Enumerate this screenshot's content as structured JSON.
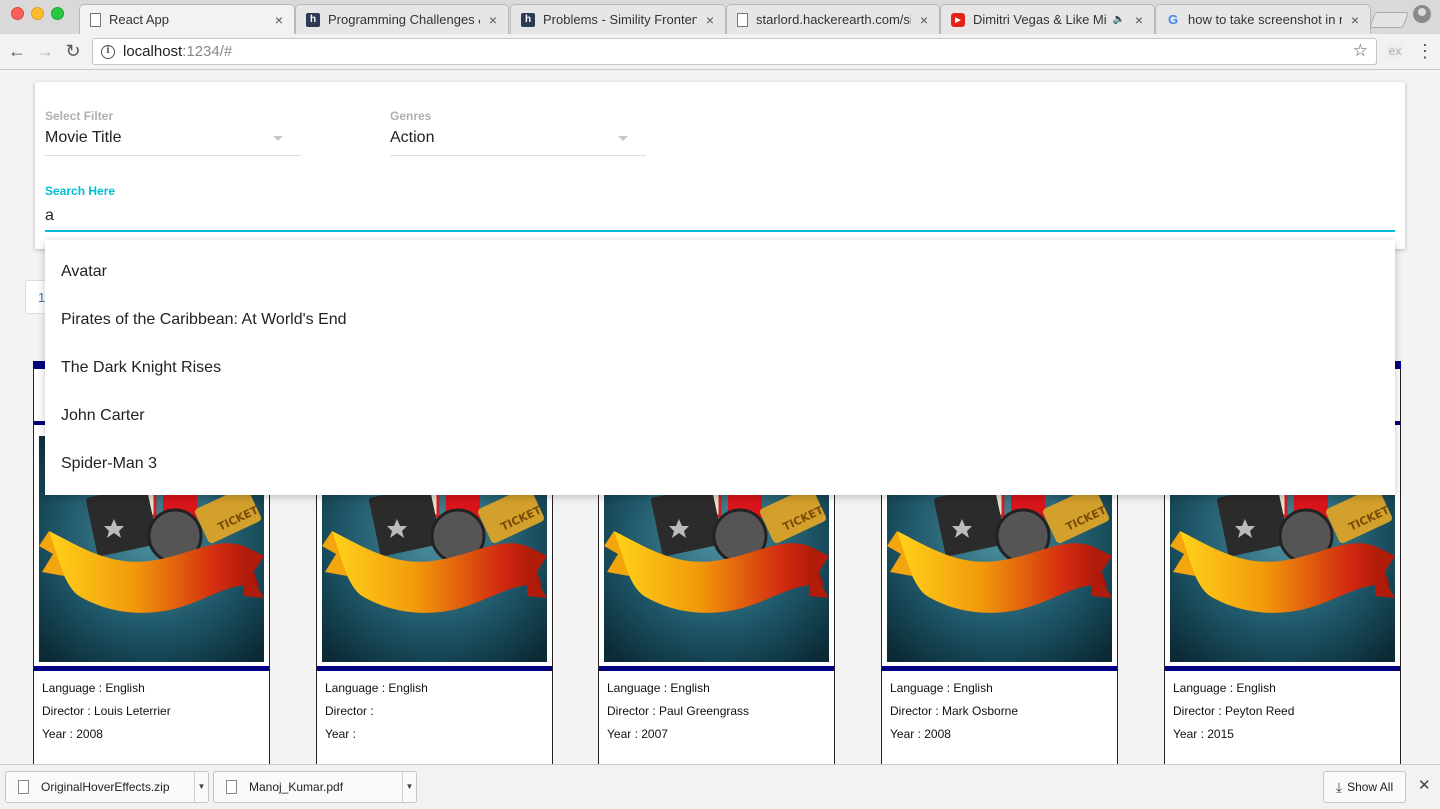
{
  "browser": {
    "tabs": [
      {
        "title": "React App",
        "icon": "document-icon",
        "active": true
      },
      {
        "title": "Programming Challenges & C",
        "icon": "hackerearth-icon"
      },
      {
        "title": "Problems - Simility Frontend",
        "icon": "hackerearth-icon"
      },
      {
        "title": "starlord.hackerearth.com/si",
        "icon": "document-icon"
      },
      {
        "title": "Dimitri Vegas & Like Mike",
        "icon": "youtube-icon",
        "audio": true
      },
      {
        "title": "how to take screenshot in m",
        "icon": "google-icon"
      }
    ],
    "url_host": "localhost",
    "url_rest": ":1234/#",
    "ext_label": "ex"
  },
  "filters": {
    "select_filter_label": "Select Filter",
    "select_filter_value": "Movie Title",
    "genres_label": "Genres",
    "genres_value": "Action",
    "search_label": "Search Here",
    "search_value": "a"
  },
  "autocomplete": [
    "Avatar",
    "Pirates of the Caribbean: At World's End",
    "The Dark Knight Rises",
    "John Carter",
    "Spider-Man 3"
  ],
  "pager_label": "1",
  "movies": [
    {
      "language": "Language : English",
      "director": "Director : Louis Leterrier",
      "year": "Year : 2008"
    },
    {
      "language": "Language : English",
      "director": "Director :",
      "year": "Year :"
    },
    {
      "language": "Language : English",
      "director": "Director : Paul Greengrass",
      "year": "Year : 2007"
    },
    {
      "language": "Language : English",
      "director": "Director : Mark Osborne",
      "year": "Year : 2008"
    },
    {
      "language": "Language : English",
      "director": "Director : Peyton Reed",
      "year": "Year : 2015"
    }
  ],
  "poster_text": "TICKET",
  "downloads": {
    "items": [
      "OriginalHoverEffects.zip",
      "Manoj_Kumar.pdf"
    ],
    "show_all": "Show All"
  },
  "colors": {
    "accent": "#00bcd4",
    "card_border": "#000080"
  }
}
